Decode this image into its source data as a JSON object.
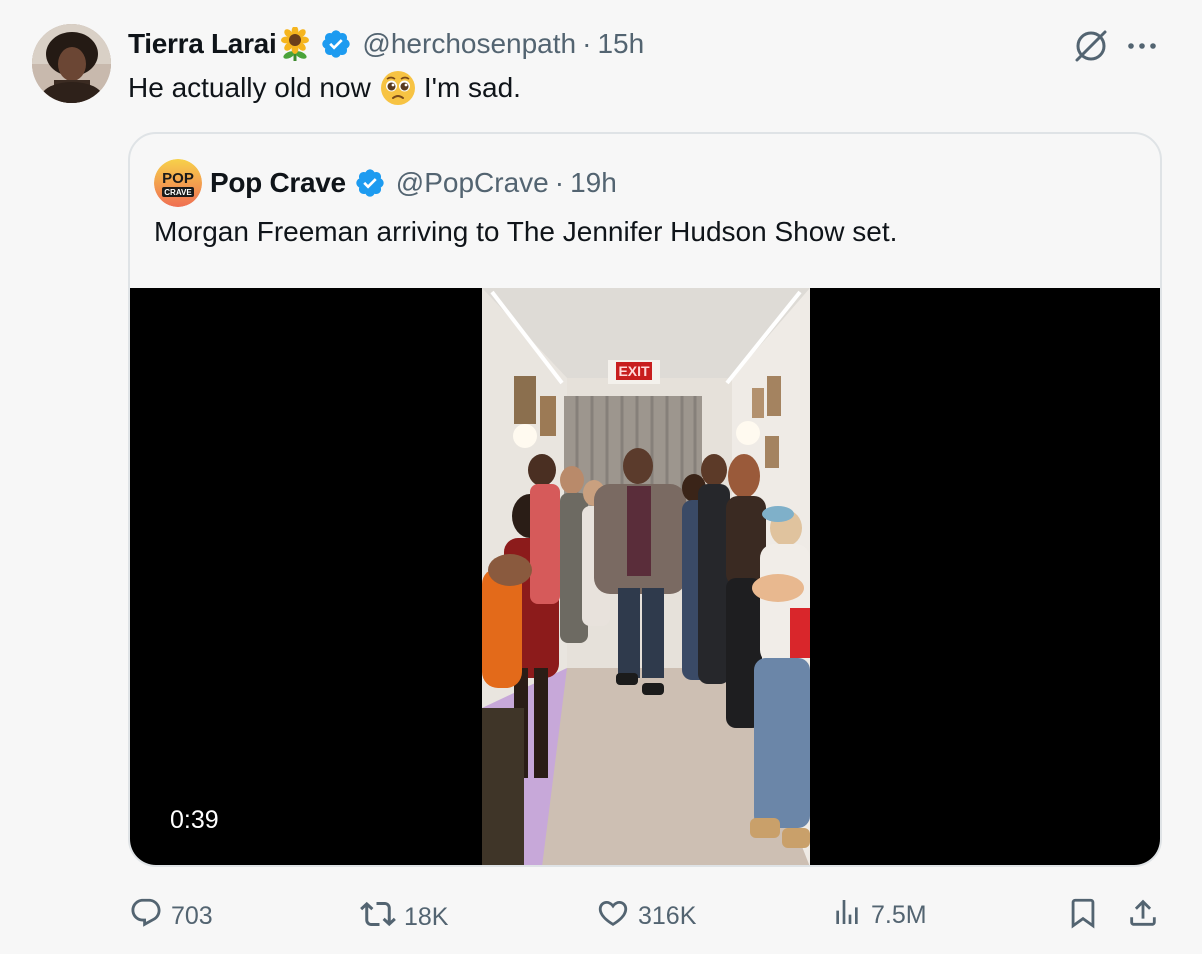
{
  "post": {
    "author": {
      "display_name": "Tierra Larai",
      "name_emoji": "sunflower",
      "handle": "@herchosenpath",
      "separator": "·",
      "time": "15h",
      "verified": true
    },
    "text_before_emoji": "He actually old now",
    "text_emoji": "pleading-face",
    "text_after_emoji": "I'm sad."
  },
  "quote": {
    "logo_text_top": "POP",
    "logo_text_bottom": "CRAVE",
    "display_name": "Pop Crave",
    "handle": "@PopCrave",
    "separator": "·",
    "time": "19h",
    "verified": true,
    "text": "Morgan Freeman arriving to The Jennifer Hudson Show set.",
    "video": {
      "duration": "0:39",
      "exit_sign": "EXIT"
    }
  },
  "actions": {
    "replies": "703",
    "reposts": "18K",
    "likes": "316K",
    "views": "7.5M"
  },
  "colors": {
    "verified": "#1d9bf0",
    "secondary_text": "#536471",
    "background": "#f7f7f7",
    "border": "#dfe3e6"
  },
  "icons": [
    "grok-icon",
    "more-icon",
    "reply-icon",
    "repost-icon",
    "like-icon",
    "views-icon",
    "bookmark-icon",
    "share-icon"
  ]
}
